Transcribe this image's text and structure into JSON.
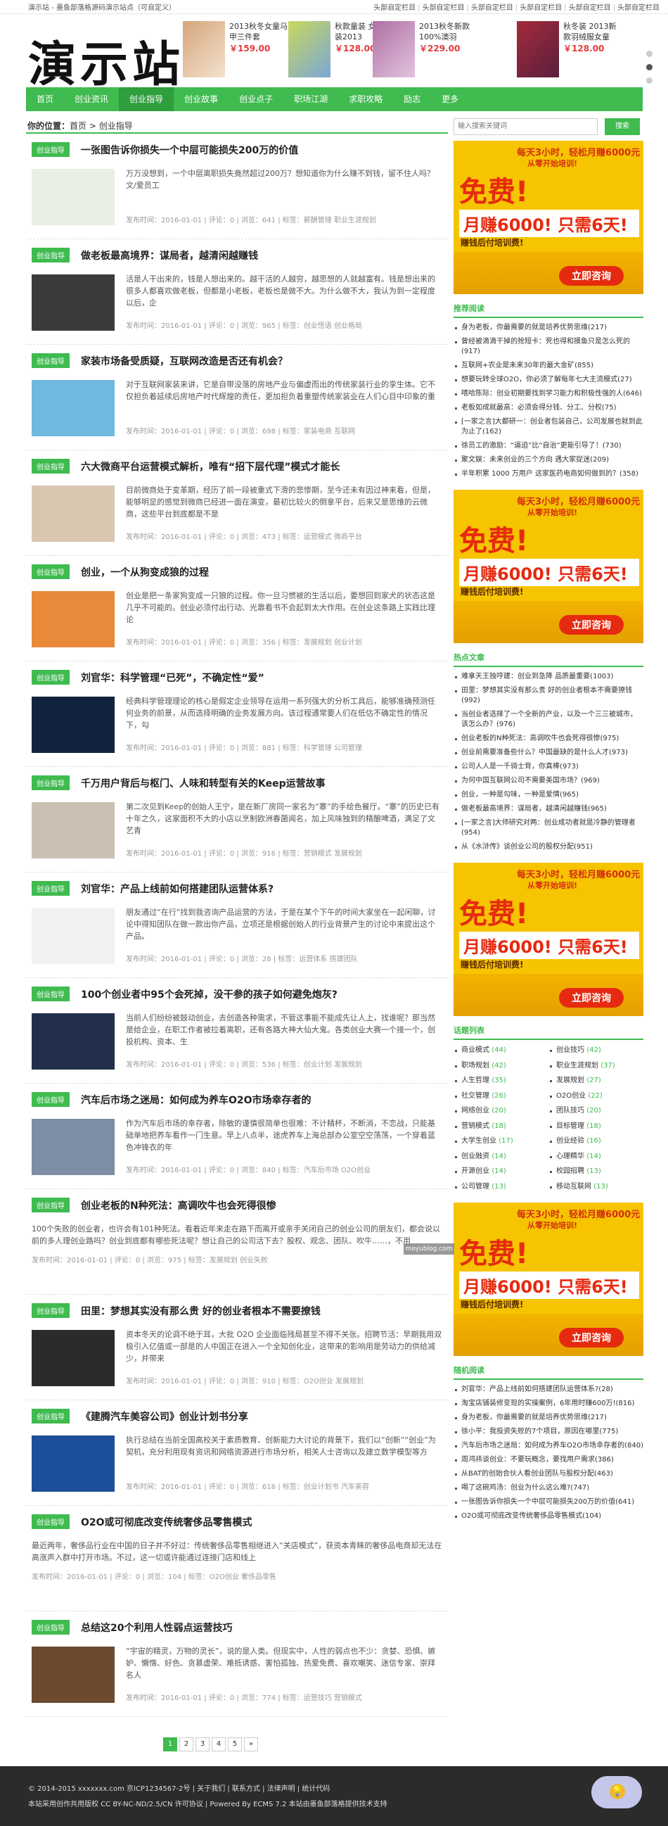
{
  "topbar": {
    "left": "演示站 - 墨鱼部落格源码演示站点（可自定义）",
    "links": [
      "头部自定栏目",
      "头部自定栏目",
      "头部自定栏目",
      "头部自定栏目",
      "头部自定栏目",
      "头部自定栏目"
    ]
  },
  "site": {
    "logo": "演示站"
  },
  "products": [
    {
      "title": "2013秋冬女童马甲三件套",
      "price": "￥159.00"
    },
    {
      "title": "秋款童装 女童 秋装2013",
      "price": "￥128.00"
    },
    {
      "title": "2013秋冬新款 100%澳羽",
      "price": "￥229.00"
    },
    {
      "title": "秋冬装 2013新款羽绒服女童",
      "price": "￥128.00"
    }
  ],
  "nav": [
    "首页",
    "创业资讯",
    "创业指导",
    "创业故事",
    "创业点子",
    "职场江湖",
    "求职攻略",
    "励志",
    "更多"
  ],
  "breadcrumb": {
    "label": "你的位置：",
    "home": "首页",
    "sep": ">",
    "current": "创业指导"
  },
  "articles": [
    {
      "tag": "创业指导",
      "title": "一张图告诉你损失一个中层可能损失200万的价值",
      "desc": "万万没想到，一个中层离职损失竟然超过200万？想知道你为什么赚不到钱，留不住人吗？ 文/爱员工",
      "meta": "发布时间：2016-01-01 | 评论：0 | 浏览：641 | 标签：",
      "tags": [
        "薪酬管理",
        "职业生涯规划"
      ]
    },
    {
      "tag": "创业指导",
      "title": "做老板最高境界：谋局者，越清闲越赚钱",
      "desc": "活是人干出来的，钱是人想出来的。越干活的人越穷，越思想的人就越富有。钱是想出来的 很多人都喜欢做老板，但都是小老板，老板也是做不大。为什么做不大，我认为到一定程度以后，企",
      "meta": "发布时间：2016-01-01 | 评论：0 | 浏览：965 | 标签：",
      "tags": [
        "创业悟语",
        "创业格局"
      ]
    },
    {
      "tag": "创业指导",
      "title": "家装市场备受质疑，互联网改造是否还有机会？",
      "desc": "对于互联网家装来讲，它是自带没落的房地产业与偏虚而出的传统家装行业的孪生体。它不仅担负着延续后房地产时代辉煌的责任，更加担负着重塑传统家装业在人们心目中印象的重",
      "meta": "发布时间：2016-01-01 | 评论：0 | 浏览：698 | 标签：",
      "tags": [
        "家装电商",
        "互联网"
      ]
    },
    {
      "tag": "创业指导",
      "title": "六大微商平台运营模式解析，唯有“招下层代理”模式才能长",
      "desc": "目前微商处于变革期，经历了前一段被重式下滑的悲惨期，至今还未有因过神来看，但是，能够明显的感觉到微商已经进一面在演变，最初比较火的倒拿平台，后来又是思维的云微商，这些平台到底都是不是",
      "meta": "发布时间：2016-01-01 | 评论：0 | 浏览：473 | 标签：",
      "tags": [
        "运营模式",
        "微商平台"
      ]
    },
    {
      "tag": "创业指导",
      "title": "创业，一个从狗变成狼的过程",
      "desc": "创业是把一条家狗变成一只狼的过程。你一旦习惯被的生活以后，要想回到家犬的状态这是几乎不可能的。创业必须付出行动、光靠看书不会起到太大作用。在创业这条路上实践比理论",
      "meta": "发布时间：2016-01-01 | 评论：0 | 浏览：356 | 标签：",
      "tags": [
        "发展规划",
        "创业计划"
      ]
    },
    {
      "tag": "创业指导",
      "title": "刘官华：科学管理“已死”，不确定性“爱”",
      "desc": "经典科学管理理论的核心是假定企业领导在运用一系列强大的分析工具后，能够准确预测任何业务的前景，从而选择明确的业务发展方向。该过程通常要人们在低估不确定性的情况下，勾",
      "meta": "发布时间：2016-01-01 | 评论：0 | 浏览：881 | 标签：",
      "tags": [
        "科学管理",
        "公司管理"
      ]
    },
    {
      "tag": "创业指导",
      "title": "千万用户背后与枢门、人味和转型有关的Keep运营故事",
      "desc": "第二次见到Keep的创始人王宁，是在新厂房同一家名为“寨”的手绘色餐厅。“寨”的历史已有十年之久，这家面积不大的小店以烹制欧洲春菌闻名，加上风味独到的精酿啤酒，满足了文艺青",
      "meta": "发布时间：2016-01-01 | 评论：0 | 浏览：916 | 标签：",
      "tags": [
        "营销模式",
        "发展规划"
      ]
    },
    {
      "tag": "创业指导",
      "title": "刘官华：产品上线前如何搭建团队运营体系?",
      "desc": "朋友通过“在行”找到我咨询产品运营的方法，于是在某个下午的时间大家坐在一起闲聊，讨论中得知团队在做一款出你产品，立项还是根据创始人的行业背景产生的讨论中来提出这个产品。",
      "meta": "发布时间：2016-01-01 | 评论：0 | 浏览：28 | 标签：",
      "tags": [
        "运营体系",
        "搭建团队"
      ]
    },
    {
      "tag": "创业指导",
      "title": "100个创业者中95个会死掉，没干参的孩子如何避免炮灰?",
      "desc": "当前人们纷纷被鼓动创业，去创造各种需求，不管这事能不能成先让人上，找谁呢？那当然是给企业，在职工作者被拉着离职，还有各路大神大仙大鬼。各类创业大赛一个接一个，创投机构、资本、生",
      "meta": "发布时间：2016-01-01 | 评论：0 | 浏览：536 | 标签：",
      "tags": [
        "创业计划",
        "发展规划"
      ]
    },
    {
      "tag": "创业指导",
      "title": "汽车后市场之迷局：如何成为养车O2O市场幸存者的",
      "desc": "作为汽车后市场的幸存者，除敏的谨慎很简单也很难：不计精杯，不断消，不恋战，只能基础单地把养车看作一门生意。早上八点半，途虎养车上海总部办公室空空荡荡，一个穿着蓝色冲锋衣的年",
      "meta": "发布时间：2016-01-01 | 评论：0 | 浏览：840 | 标签：",
      "tags": [
        "汽车后市场",
        "O2O创业"
      ]
    },
    {
      "tag": "创业指导",
      "title": "创业老板的N种死法：高调吹牛也会死得很惨",
      "desc": "100个失败的创业者，也许会有101种死法。看着近年来走在路下而离开或亲手关闭自己的创业公司的朋友们，都会说以前的多人理创业路吗？创业到底都有哪些死法呢？想让自己的公司活下去？股权、观念、团队、吹牛……，不用",
      "meta": "发布时间：2016-01-01 | 评论：0 | 浏览：975 | 标签：",
      "tags": [
        "发展规划",
        "创业失败"
      ]
    },
    {
      "tag": "创业指导",
      "title": "田里：梦想其实没有那么贵 好的创业者根本不需要撩钱",
      "desc": "资本冬天的论调不绝于耳，大批 O2O 企业面临残局甚至不得不关张。招聘节活：早期我用双极引入亿值或一部是的人中国正在进入一个全知创化业，这带来的影响用是劳动力的供给减少，并带来",
      "meta": "发布时间：2016-01-01 | 评论：0 | 浏览：910 | 标签：",
      "tags": [
        "O2O创业",
        "发展规划"
      ]
    },
    {
      "tag": "创业指导",
      "title": "《建腾汽车美容公司》创业计划书分享",
      "desc": "执行总结在当前全国高校关于素质教育、创新能力大讨论的背景下，我们以“创新”“创业”为契机，充分利用现有资讯和网络资源进行市场分析，相关人士咨询以及建立数学模型等方",
      "meta": "发布时间：2016-01-01 | 评论：0 | 浏览：616 | 标签：",
      "tags": [
        "创业计划书",
        "汽车美容"
      ]
    },
    {
      "tag": "创业指导",
      "title": "O2O或可彻底改变传统奢侈品零售模式",
      "desc": "最近两年，奢侈品行业在中国的日子并不好过：传统奢侈品零售相继进入“关店模式”，获资本青睐的奢侈品电商却无法在高涨声入群中打开市场。不过，这一切或许能通过连接门店和线上",
      "meta": "发布时间：2016-01-01 | 评论：0 | 浏览：104 | 标签：",
      "tags": [
        "O2O创业",
        "奢侈品零售"
      ]
    },
    {
      "tag": "创业指导",
      "title": "总结这20个利用人性弱点运营技巧",
      "desc": "“宇宙的精灵，万物的灵长”，说的是人类。但现实中，人性的弱点也不少：贪婪、恐惧、嫉妒、懒惰、好色、贪慕虚荣、难抵诱惑、害怕孤独、热爱免费、喜欢嘲笑、迷信专家、崇拜名人",
      "meta": "发布时间：2016-01-01 | 评论：0 | 浏览：774 | 标签：",
      "tags": [
        "运营技巧",
        "营销模式"
      ]
    }
  ],
  "pager": [
    "1",
    "2",
    "3",
    "4",
    "5",
    "»"
  ],
  "sidebar": {
    "search_placeholder": "输入搜索关键词",
    "search_button": "搜索",
    "ad": {
      "top": "每天3小时，轻松月赚6000元",
      "sub": "从零开始培训!",
      "free": "免费!",
      "big": "月赚6000! 只需6天!",
      "slogan": "赚钱后付培训费!",
      "cta": "立即咨询"
    },
    "recommend_title": "推荐阅读",
    "recommend": [
      "身为老板，你最需要的就是培养优势思维(217)",
      "曾经被滴滴干掉的抢短卡：死也得和摸鱼只是怎么死的(917)",
      "互联网+农业是未来30年的最大金矿(855)",
      "想要玩转全球O2O，你必须了解每年七大主流模式(27)",
      "嘻哈陈际：创业初期要找到学习能力和积极性强的人(646)",
      "老板如成就最高：必须会得分钱、分工、分权(75)",
      "[一家之言]大都研一：创业者包装自己，公司发展也就到此为止了(162)",
      "徐员工的激励：“逼迫”比“自治”更能引导了！(730)",
      "聚文娱：未来创业的三个方向 遇大家捉迷(209)",
      "半年积累 1000 万用户 这家医药电商如何做到的？(358)"
    ],
    "hot_title": "热点文章",
    "hot": [
      "难拿天王独哼建：创业到急降 品质最重要(1003)",
      "田里：梦想其实没有那么贵 好的创业者根本不需要撩钱(992)",
      "当创业者选择了一个全新的产业，以及一个三三被城市，该怎么办？(976)",
      "创业老板的N种死法：高调吹牛也会死得很惨(975)",
      "创业前需要准备些什么？中国最缺的是什么人才(973)",
      "公司人人是一千骑士背，你真棒(973)",
      "为何中国互联网公司不需要美国市场？(969)",
      "创业，一种是勾味，一种是爱情(965)",
      "做老板最高境界：谋局者，越清闲越赚钱(965)",
      "[一家之言]大师研究对两：创业成功者就是冷静的管理者(954)",
      "从《水浒传》谈创业公司的股权分配(951)"
    ],
    "cat_title": "话题列表",
    "cats": [
      {
        "name": "商业模式",
        "n": "(44)"
      },
      {
        "name": "创业技巧",
        "n": "(42)"
      },
      {
        "name": "职场规划",
        "n": "(42)"
      },
      {
        "name": "职业生涯规划",
        "n": "(37)"
      },
      {
        "name": "人生哲理",
        "n": "(35)"
      },
      {
        "name": "发展规划",
        "n": "(27)"
      },
      {
        "name": "社交管理",
        "n": "(26)"
      },
      {
        "name": "O2O创业",
        "n": "(22)"
      },
      {
        "name": "网络创业",
        "n": "(20)"
      },
      {
        "name": "团队技巧",
        "n": "(20)"
      },
      {
        "name": "营销模式",
        "n": "(18)"
      },
      {
        "name": "目标管理",
        "n": "(18)"
      },
      {
        "name": "大学生创业",
        "n": "(17)"
      },
      {
        "name": "创业经验",
        "n": "(16)"
      },
      {
        "name": "创业融资",
        "n": "(14)"
      },
      {
        "name": "心理精华",
        "n": "(14)"
      },
      {
        "name": "开源创业",
        "n": "(14)"
      },
      {
        "name": "校园招聘",
        "n": "(13)"
      },
      {
        "name": "公司管理",
        "n": "(13)"
      },
      {
        "name": "移动互联网",
        "n": "(13)"
      }
    ],
    "random_title": "随机阅读",
    "random": [
      "刘官华：产品上线前如何搭建团队运营体系?(28)",
      "淘宝店铺装修变现的实操案例，6年用时赚600万!(816)",
      "身为老板，你最需要的就是培养优势思维(217)",
      "徐小平：我投资失败的7个项目，原因在哪里(775)",
      "汽车后市场之迷局：如何成为养车O2O市场幸存者的(840)",
      "周鸿祎谈创业：不要玩概念，要找用户需求(386)",
      "从BAT的创始合伙人看创业团队与股权分配(463)",
      "喝了这碗鸡汤：创业为什么这么难?(747)",
      "一张图告诉你损失一个中层可能损失200万的价值(641)",
      "O2O或可彻底改变传统奢侈品零售模式(104)"
    ]
  },
  "footer": {
    "line1": "© 2014-2015 xxxxxxx.com 京ICP1234567-2号 | 关于我们 | 联系方式 | 法律声明 | 统计代码",
    "line2": "本站采用创作共用版权 CC BY-NC-ND/2.5/CN 许可协议 | Powered By ECMS 7.2 本站由墨鱼部落格提供技术支持"
  },
  "watermark": "moyublog.com",
  "colors": {
    "accent": "#3fbb4f",
    "price": "#e4393c",
    "footer": "#2b2b2b"
  }
}
